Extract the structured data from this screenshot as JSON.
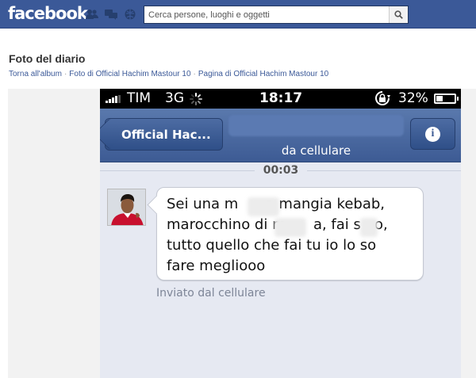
{
  "facebook": {
    "logo": "facebook",
    "search_placeholder": "Cerca persone, luoghi e oggetti",
    "brand_color": "#3b5998",
    "icons": [
      "friend-requests-icon",
      "messages-icon",
      "notifications-icon",
      "search-icon"
    ]
  },
  "page": {
    "title": "Foto del diario",
    "breadcrumb": {
      "back": "Torna all'album",
      "photos_of": "Foto di Official Hachim Mastour 10",
      "page_of": "Pagina di Official Hachim Mastour 10"
    }
  },
  "photo": {
    "status_bar": {
      "carrier": "TIM",
      "network": "3G",
      "time": "18:17",
      "battery": "32%"
    },
    "nav": {
      "back_label": "Official Hac...",
      "subtitle": "da cellulare",
      "accent_color": "#3d5b94"
    },
    "conversation": {
      "timestamp": "00:03",
      "message_lines": [
        "Sei una m      a mangia kebab,",
        "marocchino di m      a, fai s   o,",
        "tutto quello che fai tu io lo so",
        "fare megliooo"
      ],
      "sent_via": "Inviato dal cellulare"
    }
  }
}
